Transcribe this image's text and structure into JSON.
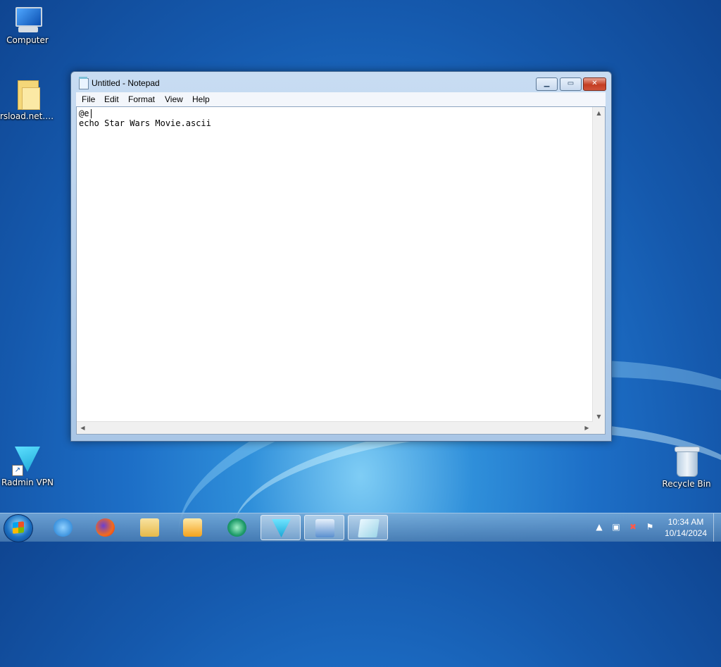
{
  "desktop": {
    "icons": [
      {
        "label": "Computer",
        "icon": "computer-icon"
      },
      {
        "label": "rsload.net.P...",
        "icon": "folder-icon"
      },
      {
        "label": "Radmin VPN",
        "icon": "radmin-vpn-icon"
      },
      {
        "label": "Recycle Bin",
        "icon": "recycle-bin-icon"
      }
    ]
  },
  "window": {
    "title": "Untitled - Notepad",
    "menu": [
      "File",
      "Edit",
      "Format",
      "View",
      "Help"
    ],
    "content": "@e\necho Star Wars Movie.ascii"
  },
  "taskbar": {
    "start_icon": "windows-start-icon",
    "pinned": [
      {
        "icon": "internet-explorer-icon",
        "active": false
      },
      {
        "icon": "firefox-icon",
        "active": false
      },
      {
        "icon": "file-explorer-icon",
        "active": false
      },
      {
        "icon": "media-player-icon",
        "active": false
      },
      {
        "icon": "green-app-icon",
        "active": false
      },
      {
        "icon": "radmin-vpn-icon",
        "active": true
      },
      {
        "icon": "remote-desktop-icon",
        "active": true
      },
      {
        "icon": "notepad-icon",
        "active": true
      }
    ],
    "tray": {
      "icons": [
        "show-hidden-icons-chevron-icon",
        "network-icon",
        "volume-muted-icon",
        "action-center-flag-icon"
      ],
      "time": "10:34 AM",
      "date": "10/14/2024"
    }
  },
  "colors": {
    "desktop_blue": "#1d6fc7",
    "close_red": "#c43d22",
    "window_frame": "#a9c6e6"
  }
}
